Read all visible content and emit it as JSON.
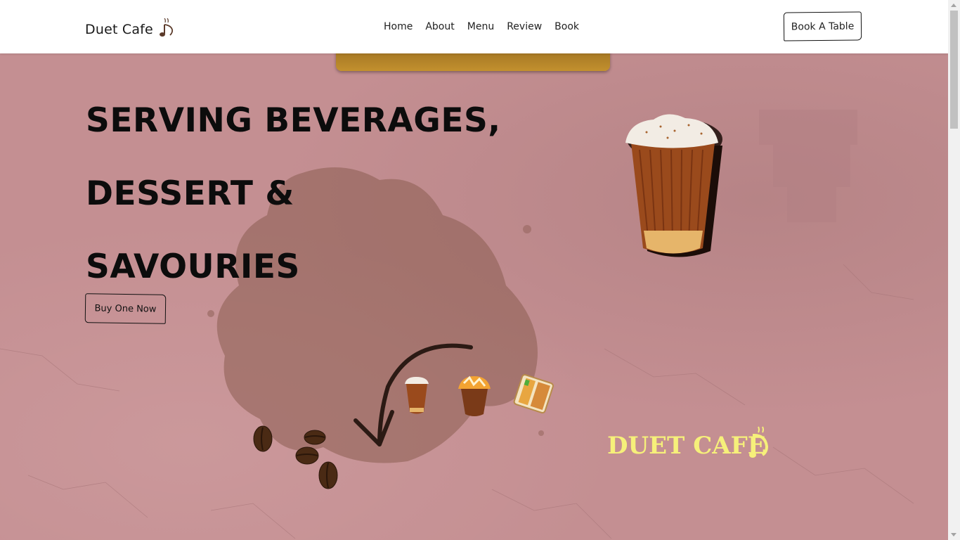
{
  "header": {
    "brand": "Duet Cafe",
    "brand_icon": "music-note-coffee-icon",
    "nav": [
      {
        "label": "Home"
      },
      {
        "label": "About"
      },
      {
        "label": "Menu"
      },
      {
        "label": "Review"
      },
      {
        "label": "Book"
      }
    ],
    "book_button": "Book A Table"
  },
  "hero": {
    "headline": [
      "SERVING BEVERAGES,",
      "DESSERT &",
      "SAVOURIES"
    ],
    "buy_button": "Buy One Now",
    "logo_text": "DUET CAFE"
  },
  "colors": {
    "background": "#c48f92",
    "stain": "#8a5c50",
    "logo": "#f6f07a",
    "text": "#0c0c0c"
  }
}
